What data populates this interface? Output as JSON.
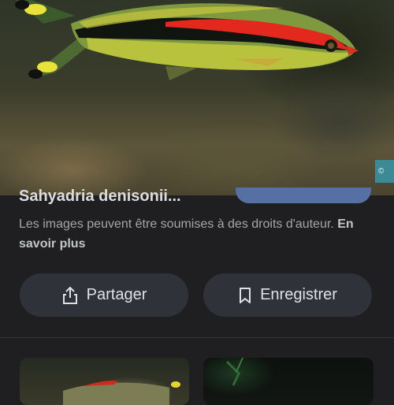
{
  "image": {
    "alt_icon": "fish-photo",
    "watermark": "©"
  },
  "details": {
    "title": "Sahyadria denisonii...",
    "copyright_text": "Les images peuvent être soumises à des droits d'auteur.",
    "learn_more_label": "En savoir plus"
  },
  "actions": {
    "share_label": "Partager",
    "save_label": "Enregistrer"
  },
  "colors": {
    "background": "#1f1f22",
    "pill": "#30323a",
    "visit_button": "#5670a3"
  },
  "related": {
    "thumbnails": [
      "fish-thumbnail",
      "aquarium-thumbnail"
    ]
  }
}
